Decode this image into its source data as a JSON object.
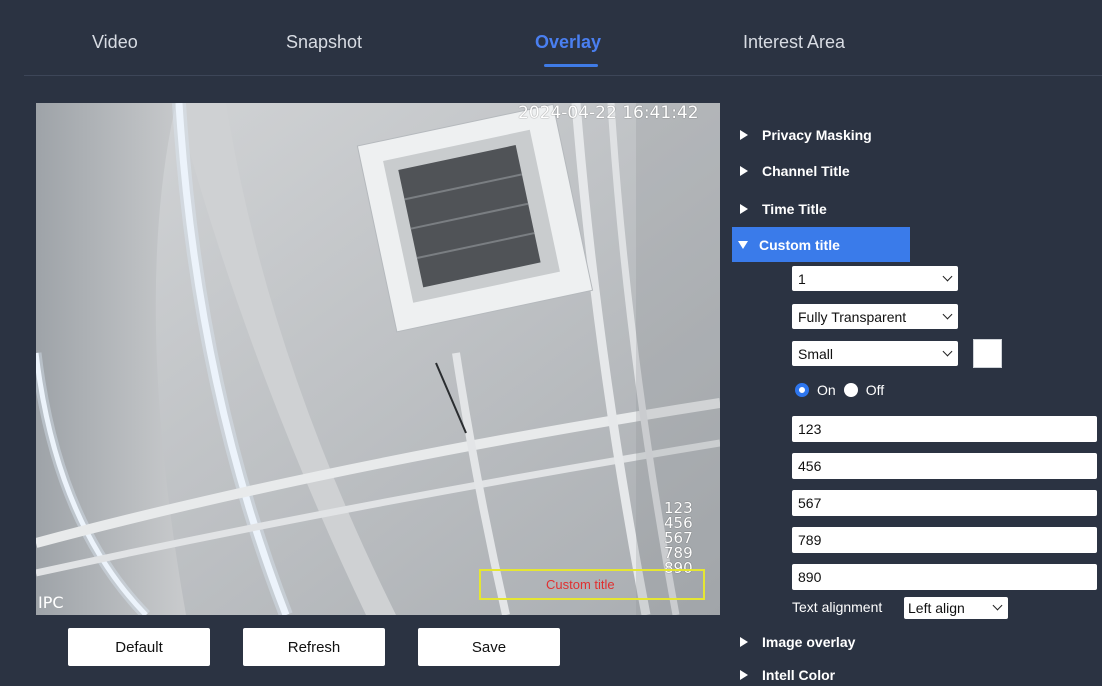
{
  "tabs": [
    {
      "label": "Video"
    },
    {
      "label": "Snapshot"
    },
    {
      "label": "Overlay",
      "active": true
    },
    {
      "label": "Interest Area"
    }
  ],
  "video": {
    "timestamp": "2024-04-22 16:41:42",
    "custom_lines": [
      "123",
      "456",
      "567",
      "789",
      "890"
    ],
    "custom_title": "Custom title",
    "channel_label": "IPC"
  },
  "buttons": {
    "default": "Default",
    "refresh": "Refresh",
    "save": "Save"
  },
  "sections": {
    "privacy_masking": "Privacy Masking",
    "channel_title": "Channel Title",
    "time_title": "Time Title",
    "custom_title": "Custom title",
    "image_overlay": "Image overlay",
    "intell_color": "Intell Color"
  },
  "custom_title_form": {
    "index": "1",
    "transparency": "Fully Transparent",
    "size": "Small",
    "swatch_color": "#ffffff",
    "on_label": "On",
    "off_label": "Off",
    "state": "On",
    "lines": [
      "123",
      "456",
      "567",
      "789",
      "890"
    ],
    "alignment_label": "Text alignment",
    "alignment_value": "Left align"
  },
  "colors": {
    "background": "#2b3342",
    "accent": "#3a7bea",
    "osd_box": "#e5e632",
    "osd_custom_text": "#e03030"
  }
}
